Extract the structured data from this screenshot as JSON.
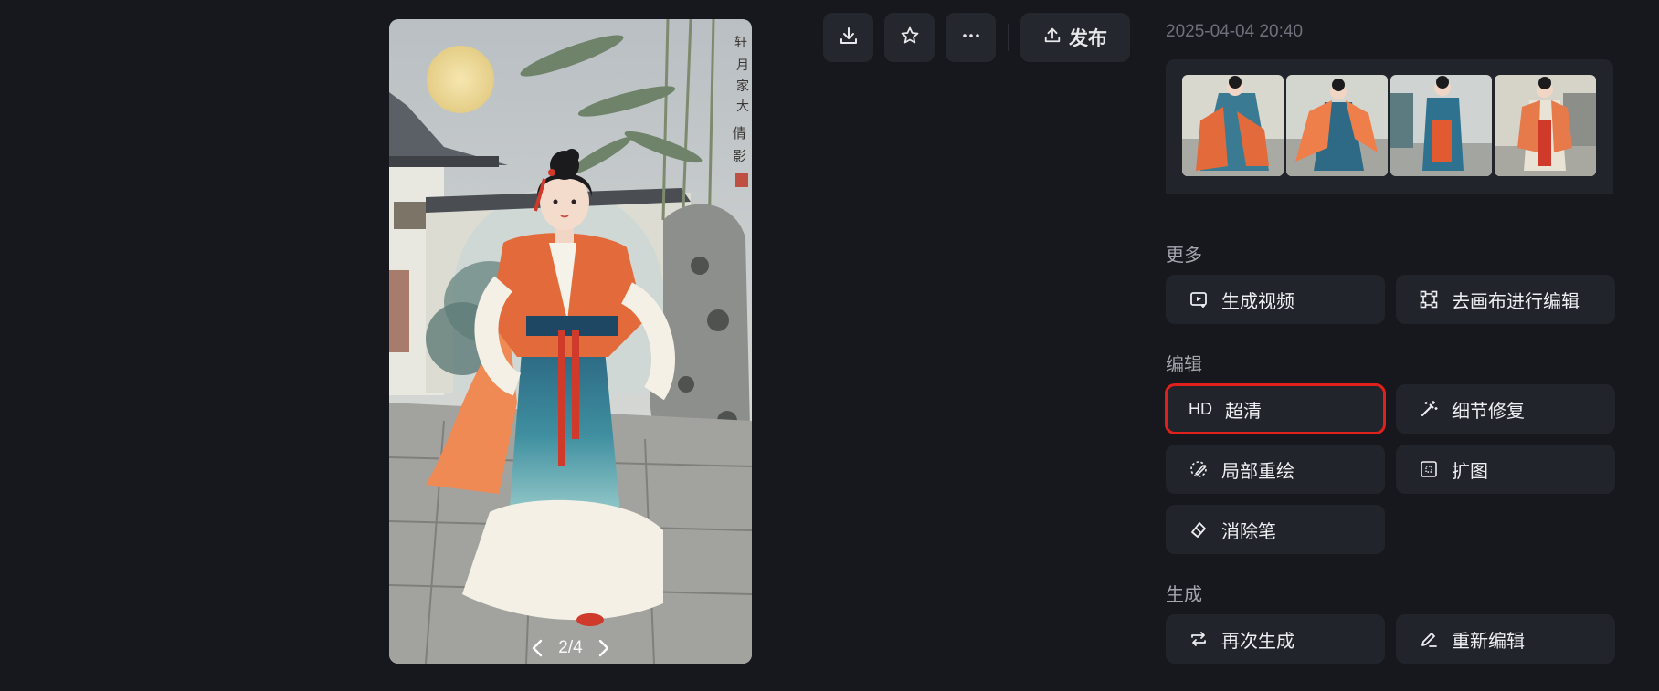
{
  "preview": {
    "pager_text": "2/4",
    "prev_icon": "chevron-left-icon",
    "next_icon": "chevron-right-icon"
  },
  "toolbar": {
    "download_icon": "download-icon",
    "favorite_icon": "star-icon",
    "more_icon": "more-horizontal-icon",
    "publish_label": "发布",
    "publish_icon": "upload-icon"
  },
  "timestamp": "2025-04-04 20:40",
  "thumbnails": {
    "count": 4
  },
  "sections": {
    "more": {
      "title": "更多",
      "buttons": [
        {
          "label": "生成视频",
          "icon": "video-play-icon"
        },
        {
          "label": "去画布进行编辑",
          "icon": "canvas-frame-icon"
        }
      ]
    },
    "edit": {
      "title": "编辑",
      "buttons": [
        {
          "label": "超清",
          "icon_text": "HD",
          "highlighted": true
        },
        {
          "label": "细节修复",
          "icon": "magic-wand-icon"
        },
        {
          "label": "局部重绘",
          "icon": "brush-icon"
        },
        {
          "label": "扩图",
          "icon": "expand-frame-icon"
        },
        {
          "label": "消除笔",
          "icon": "eraser-icon"
        }
      ]
    },
    "generate": {
      "title": "生成",
      "buttons": [
        {
          "label": "再次生成",
          "icon": "repeat-icon"
        },
        {
          "label": "重新编辑",
          "icon": "pencil-icon"
        }
      ]
    }
  },
  "colors": {
    "background": "#17181d",
    "button": "#22242b",
    "highlight_border": "#e0201c",
    "muted_text": "#6e717b"
  }
}
